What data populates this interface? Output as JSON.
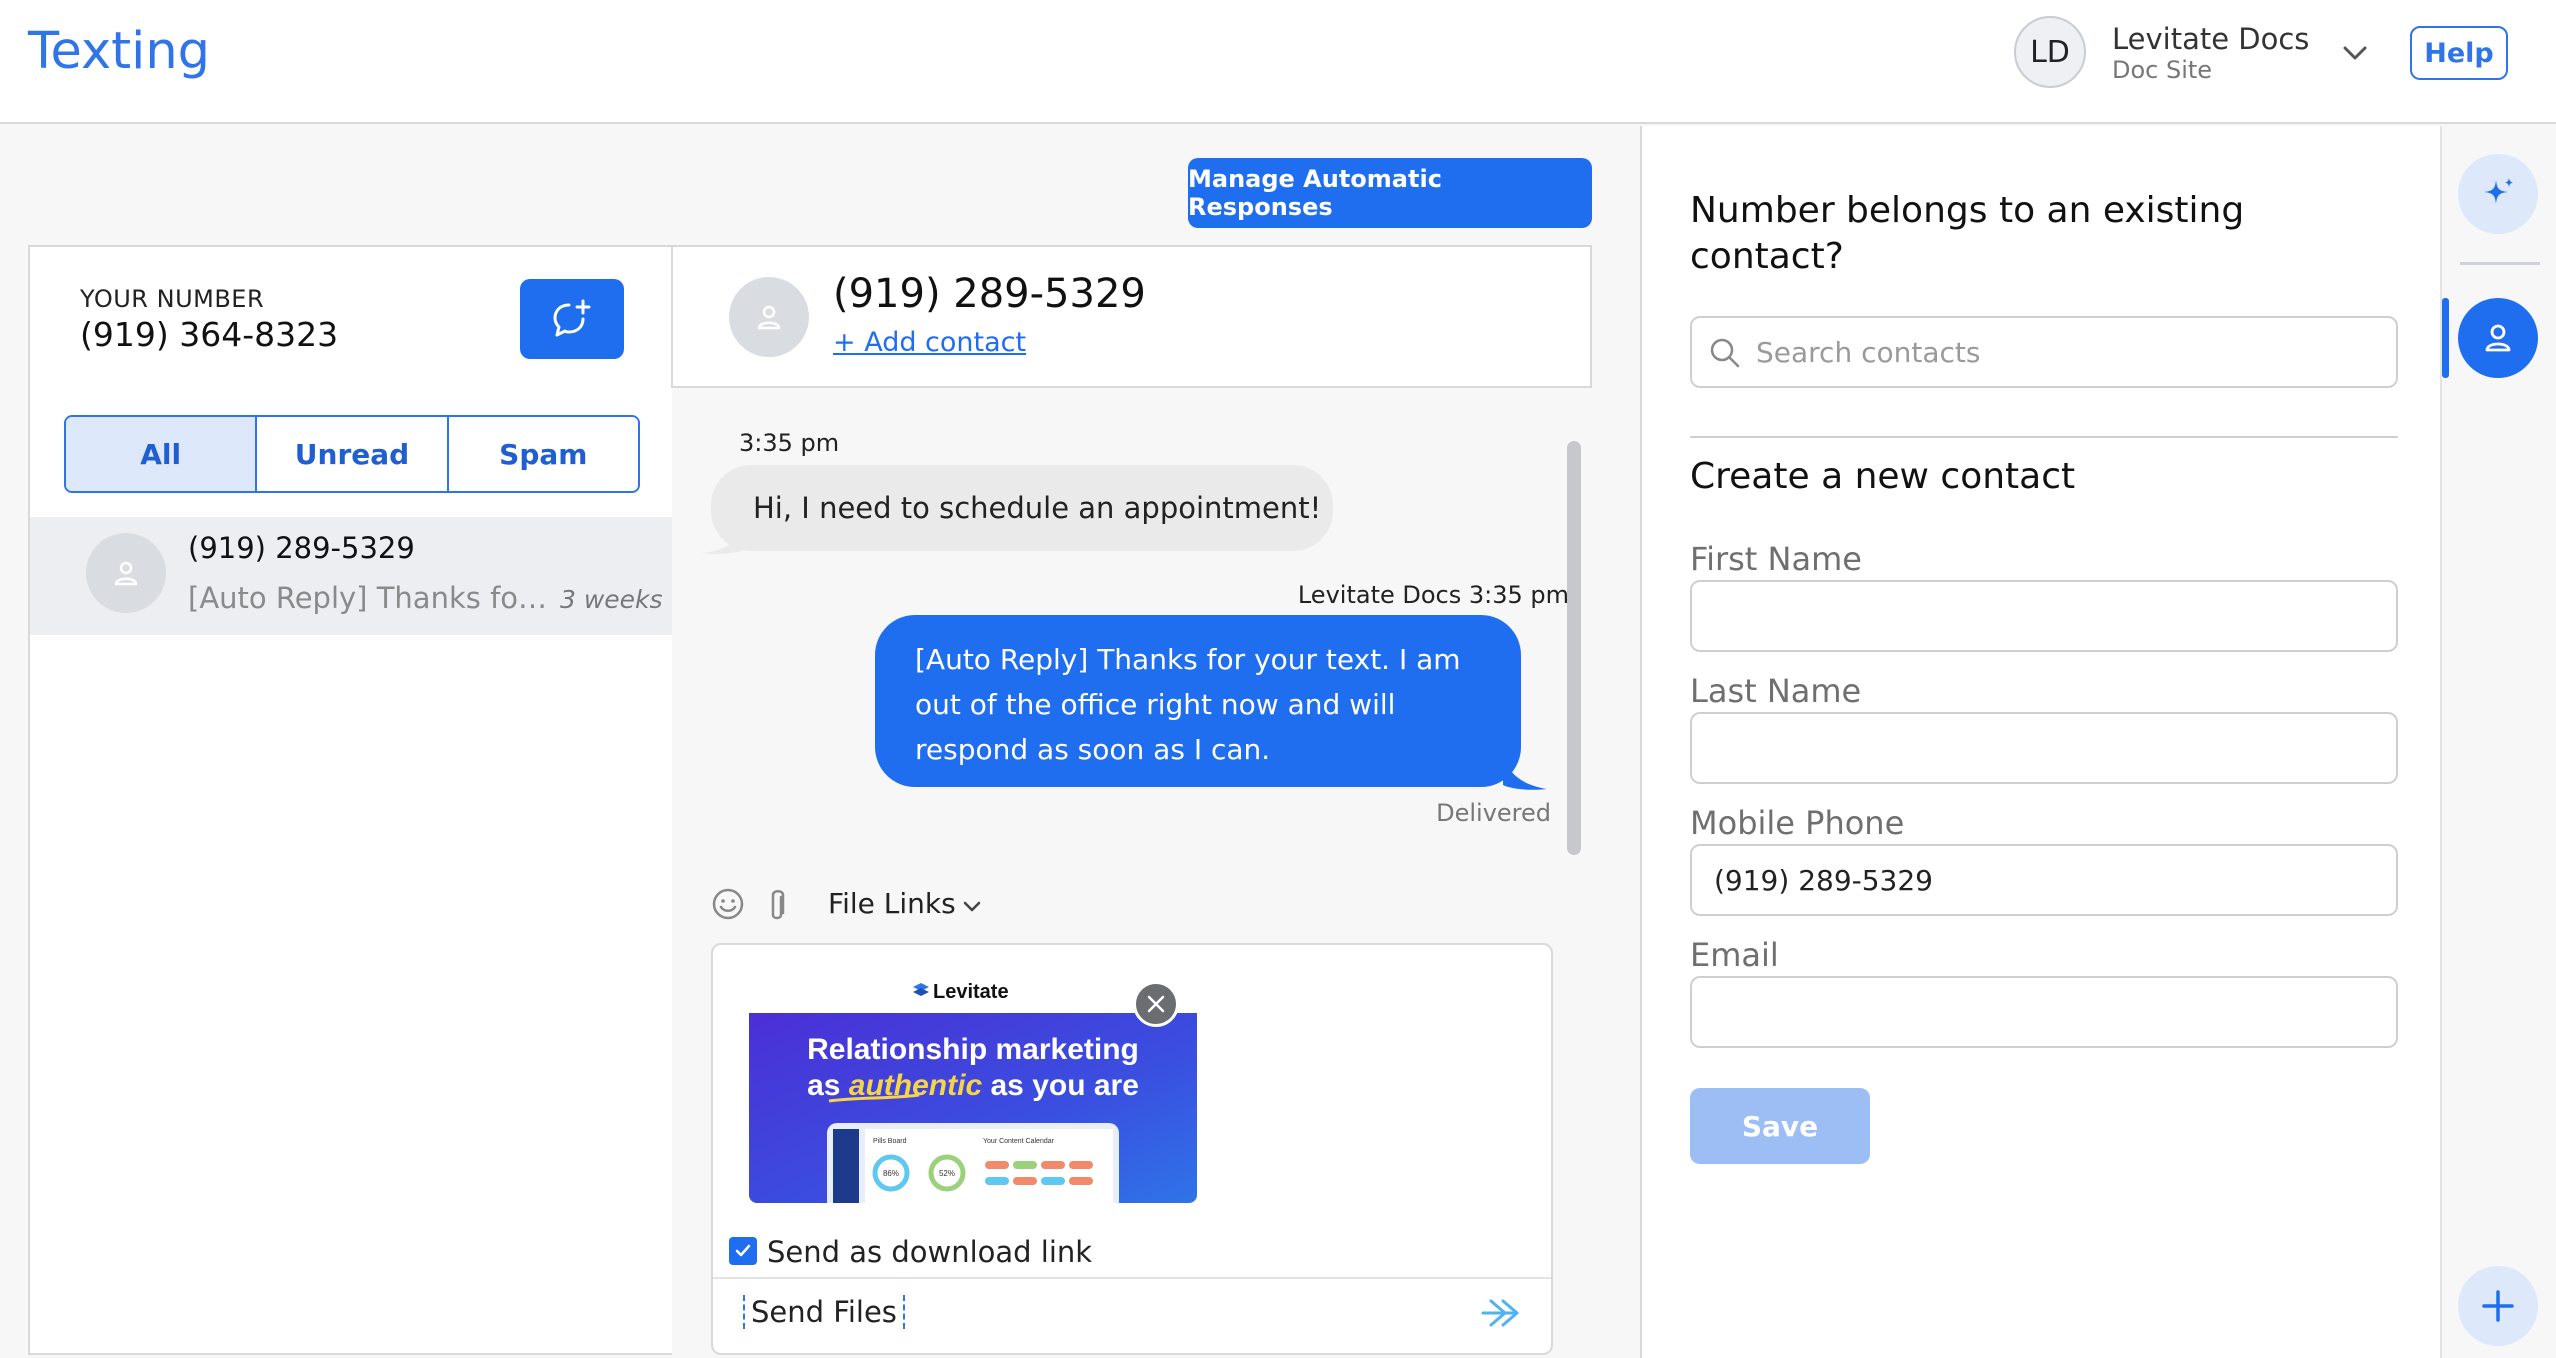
{
  "header": {
    "title": "Texting",
    "user_initials": "LD",
    "user_name": "Levitate Docs",
    "user_site": "Doc Site",
    "help_label": "Help"
  },
  "actions": {
    "manage_auto_responses": "Manage Automatic Responses"
  },
  "conversations": {
    "your_number_label": "YOUR NUMBER",
    "your_number": "(919) 364-8323",
    "filters": [
      "All",
      "Unread",
      "Spam"
    ],
    "active_filter": "All",
    "items": [
      {
        "number": "(919) 289-5329",
        "preview": "[Auto Reply] Thanks for your text. I am out of the office right now and will respond as soon as I can.",
        "time": "3 weeks"
      }
    ]
  },
  "thread": {
    "contact_number": "(919) 289-5329",
    "add_contact_label": "+ Add contact",
    "messages": [
      {
        "direction": "in",
        "time": "3:35 pm",
        "text": "Hi, I need to schedule an appointment!"
      },
      {
        "direction": "out",
        "sender": "Levitate Docs 3:35 pm",
        "text": "[Auto Reply] Thanks for your text. I am out of the office right now and will respond as soon as I can.",
        "status": "Delivered"
      }
    ],
    "composer": {
      "file_links_label": "File Links",
      "preview": {
        "brand": "Levitate",
        "headline_1": "Relationship marketing",
        "headline_2a": "as ",
        "headline_2b": "authentic",
        "headline_2c": " as you are",
        "dash_left": "Pills Board",
        "dash_right": "Your Content Calendar",
        "gauge_1": "86%",
        "gauge_2": "52%"
      },
      "send_as_download_link": true,
      "send_as_download_label": "Send as download link",
      "text": "Send Files"
    }
  },
  "contact_panel": {
    "question": "Number belongs to an existing contact?",
    "search_placeholder": "Search contacts",
    "create_title": "Create a new contact",
    "fields": [
      {
        "label": "First Name",
        "value": ""
      },
      {
        "label": "Last Name",
        "value": ""
      },
      {
        "label": "Mobile Phone",
        "value": "(919) 289-5329"
      },
      {
        "label": "Email",
        "value": ""
      }
    ],
    "save_label": "Save"
  },
  "colors": {
    "accent": "#1f6ef0",
    "title_blue": "#2f74e8",
    "disabled_button": "#9dbdf5",
    "incoming_bubble": "#eaeaeb"
  }
}
